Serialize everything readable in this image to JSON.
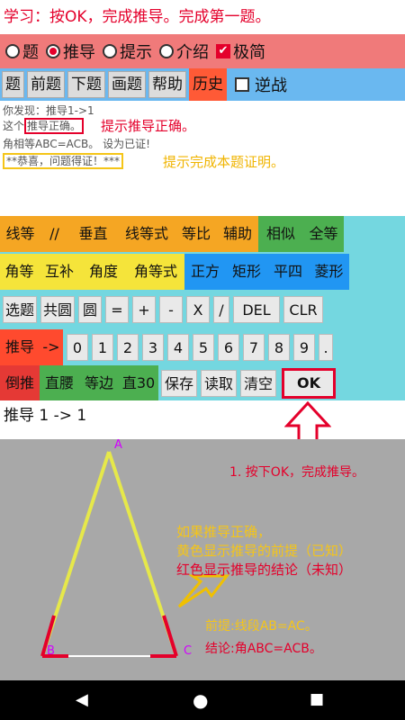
{
  "top_title": "学习：按OK，完成推导。完成第一题。",
  "modes": [
    {
      "label": "题",
      "state": "radio-off"
    },
    {
      "label": "推导",
      "state": "radio-on"
    },
    {
      "label": "提示",
      "state": "radio-off"
    },
    {
      "label": "介绍",
      "state": "radio-off"
    },
    {
      "label": "极简",
      "state": "check-on"
    }
  ],
  "menu": {
    "items": [
      "题",
      "前题",
      "下题",
      "画题",
      "帮助"
    ],
    "history": "历史",
    "reverse": "逆战"
  },
  "messages": {
    "line1": "你发现：推导1->1",
    "line2_prefix": "这个",
    "line2_boxed": "推导正确。",
    "line3": "角相等ABC=ACB。 设为已证!",
    "line4_boxed": "**恭喜，问题得证！***"
  },
  "annotations": {
    "hint_correct": "提示推导正确。",
    "hint_done": "提示完成本题证明。",
    "press_ok": "1. 按下OK，完成推导。",
    "explain_1": "如果推导正确，",
    "explain_2": "黄色显示推导的前提（已知）",
    "explain_3": "红色显示推导的结论（未知）",
    "premise": "前提:线段AB=AC。",
    "conclusion": "结论:角ABC=ACB。"
  },
  "keypad": {
    "row1": [
      {
        "label": "线等",
        "color": "#f5a623"
      },
      {
        "label": "//",
        "color": "#f5a623"
      },
      {
        "label": "垂直",
        "color": "#f5a623"
      },
      {
        "label": "线等式",
        "color": "#f5a623"
      },
      {
        "label": "等比",
        "color": "#f5a623"
      },
      {
        "label": "辅助",
        "color": "#f5a623"
      },
      {
        "label": "相似",
        "color": "#4caf50"
      },
      {
        "label": "全等",
        "color": "#4caf50"
      }
    ],
    "row2": [
      {
        "label": "角等",
        "color": "#f5e43a"
      },
      {
        "label": "互补",
        "color": "#f5e43a"
      },
      {
        "label": "角度",
        "color": "#f5e43a"
      },
      {
        "label": "角等式",
        "color": "#f5e43a"
      },
      {
        "label": "正方",
        "color": "#2196f3"
      },
      {
        "label": "矩形",
        "color": "#2196f3"
      },
      {
        "label": "平四",
        "color": "#2196f3"
      },
      {
        "label": "菱形",
        "color": "#2196f3"
      }
    ],
    "row3": [
      "选题",
      "共圆",
      "圆",
      "=",
      "+",
      "-",
      "X",
      "/",
      "DEL",
      "CLR"
    ],
    "row4_derive": "推导",
    "row4_arrow": "->",
    "row4_digits": [
      "0",
      "1",
      "2",
      "3",
      "4",
      "5",
      "6",
      "7",
      "8",
      "9",
      "."
    ],
    "row5": [
      {
        "label": "倒推",
        "color": "#e53935"
      },
      {
        "label": "直腰",
        "color": "#4caf50"
      },
      {
        "label": "等边",
        "color": "#4caf50"
      },
      {
        "label": "直30",
        "color": "#4caf50"
      }
    ],
    "row5_gray": [
      "保存",
      "读取",
      "清空"
    ],
    "ok": "OK"
  },
  "status_line": "推导 1 -> 1",
  "figure": {
    "vertex_a": "A",
    "vertex_b": "B",
    "vertex_c": "C"
  },
  "nav": {
    "back": "◀",
    "home": "●",
    "recent": "■"
  }
}
